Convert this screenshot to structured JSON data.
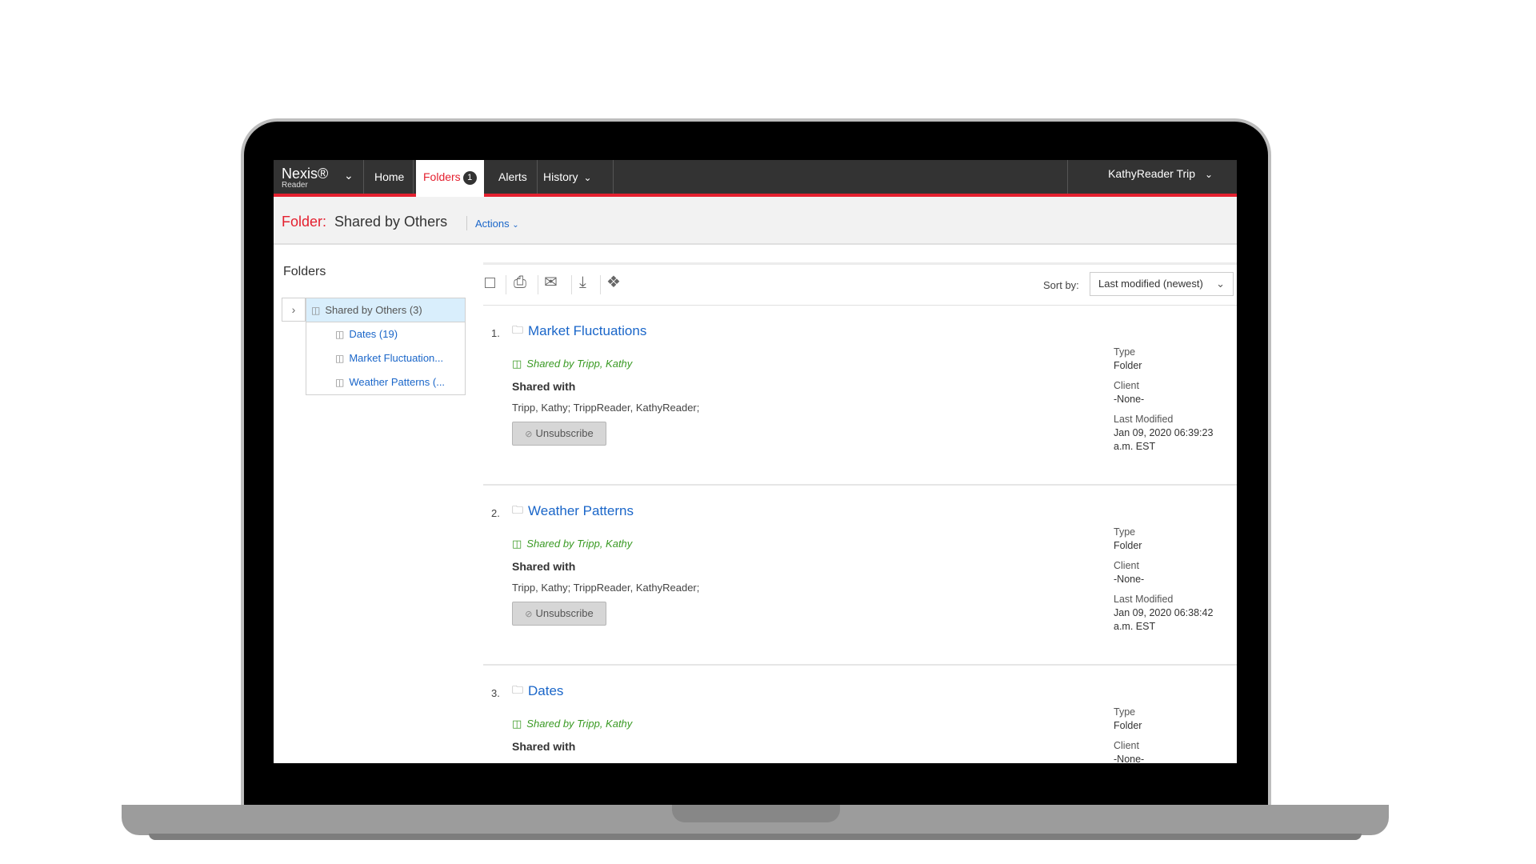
{
  "nav": {
    "logo_main": "Nexis®",
    "logo_sub": "Reader",
    "items": [
      {
        "label": "Home"
      },
      {
        "label": "Folders",
        "badge": "1"
      },
      {
        "label": "Alerts"
      },
      {
        "label": "History"
      }
    ],
    "user": "KathyReader Trip"
  },
  "folder_header": {
    "label": "Folder:",
    "name": "Shared by Others",
    "actions": "Actions"
  },
  "sidebar": {
    "title": "Folders",
    "tree": [
      {
        "label": "Shared by Others (3)"
      },
      {
        "label": "Dates (19)"
      },
      {
        "label": "Market Fluctuation..."
      },
      {
        "label": "Weather Patterns (..."
      }
    ]
  },
  "toolbar": {
    "sort_label": "Sort by:",
    "sort_value": "Last modified (newest)"
  },
  "results": [
    {
      "num": "1.",
      "title": "Market Fluctuations",
      "shared_by": "Shared by Tripp, Kathy",
      "shared_with_label": "Shared with",
      "shared_with": "Tripp, Kathy; TrippReader, KathyReader;",
      "button": "Unsubscribe",
      "type_label": "Type",
      "type": "Folder",
      "client_label": "Client",
      "client": "-None-",
      "modified_label": "Last Modified",
      "modified": "Jan 09, 2020  06:39:23 a.m. EST"
    },
    {
      "num": "2.",
      "title": "Weather Patterns",
      "shared_by": "Shared by Tripp, Kathy",
      "shared_with_label": "Shared with",
      "shared_with": "Tripp, Kathy; TrippReader, KathyReader;",
      "button": "Unsubscribe",
      "type_label": "Type",
      "type": "Folder",
      "client_label": "Client",
      "client": "-None-",
      "modified_label": "Last Modified",
      "modified": "Jan 09, 2020  06:38:42 a.m. EST"
    },
    {
      "num": "3.",
      "title": "Dates",
      "shared_by": "Shared by Tripp, Kathy",
      "shared_with_label": "Shared with",
      "type_label": "Type",
      "type": "Folder",
      "client_label": "Client",
      "client": "-None-"
    }
  ]
}
